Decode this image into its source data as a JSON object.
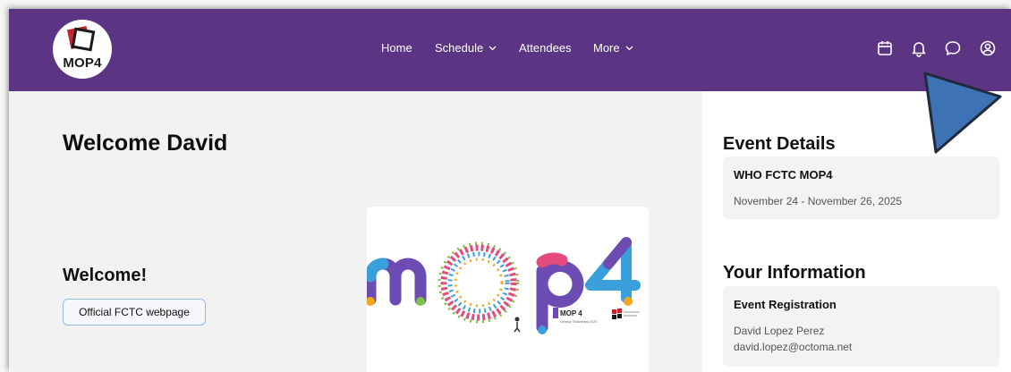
{
  "header": {
    "logo_text": "MOP4",
    "nav": [
      {
        "label": "Home"
      },
      {
        "label": "Schedule"
      },
      {
        "label": "Attendees"
      },
      {
        "label": "More"
      }
    ],
    "icons": [
      "calendar-icon",
      "bell-icon",
      "chat-icon",
      "user-icon"
    ]
  },
  "main": {
    "title": "Welcome David",
    "subtitle": "Welcome!",
    "button_label": "Official FCTC webpage",
    "banner": {
      "wordmark": "mop4",
      "badge_main": "MOP 4",
      "badge_sub": "Geneva, Switzerland 2025"
    }
  },
  "sidebar": {
    "event_heading": "Event Details",
    "event_name": "WHO FCTC MOP4",
    "event_dates": "November 24 - November 26, 2025",
    "info_heading": "Your Information",
    "registration_title": "Event Registration",
    "user_name": "David Lopez Perez",
    "user_email": "david.lopez@octoma.net"
  },
  "colors": {
    "header_bg": "#5b3583",
    "cursor": "#3d72b4"
  }
}
